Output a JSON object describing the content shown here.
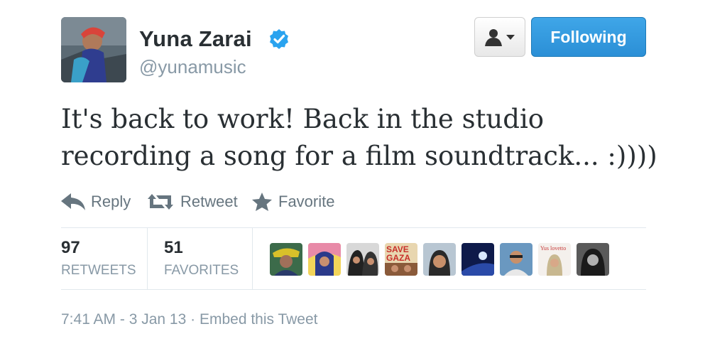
{
  "user": {
    "name": "Yuna Zarai",
    "handle": "@yunamusic",
    "verified_icon": "verified-badge-icon",
    "accent_color": "#2aa3ef"
  },
  "buttons": {
    "user_menu_icon": "person-dropdown-icon",
    "follow_label": "Following"
  },
  "tweet": {
    "text_line1": "It's back to work! Back in the studio",
    "text_line2": "recording a song for a film soundtrack... :))))"
  },
  "actions": [
    {
      "label": "Reply",
      "icon": "reply-icon"
    },
    {
      "label": "Retweet",
      "icon": "retweet-icon"
    },
    {
      "label": "Favorite",
      "icon": "star-icon"
    }
  ],
  "stats": {
    "retweets": {
      "count": "97",
      "label": "RETWEETS"
    },
    "favorites": {
      "count": "51",
      "label": "FAVORITES"
    }
  },
  "faces": [
    {
      "name": "avatar-1",
      "color": "#3c6b4a"
    },
    {
      "name": "avatar-2",
      "color": "#e8b04a"
    },
    {
      "name": "avatar-3",
      "color": "#2d2d3a"
    },
    {
      "name": "avatar-4",
      "color": "#c83a2a",
      "text": "SAVE GAZA"
    },
    {
      "name": "avatar-5",
      "color": "#a8b8c6"
    },
    {
      "name": "avatar-6",
      "color": "#1b2a6b"
    },
    {
      "name": "avatar-7",
      "color": "#5a88b0"
    },
    {
      "name": "avatar-8",
      "color": "#f4f0ec",
      "text": "Yus lovetto"
    },
    {
      "name": "avatar-9",
      "color": "#3a3a3a"
    }
  ],
  "footer": {
    "time": "7:41 AM - 3 Jan 13",
    "separator": "·",
    "embed": "Embed this Tweet"
  }
}
